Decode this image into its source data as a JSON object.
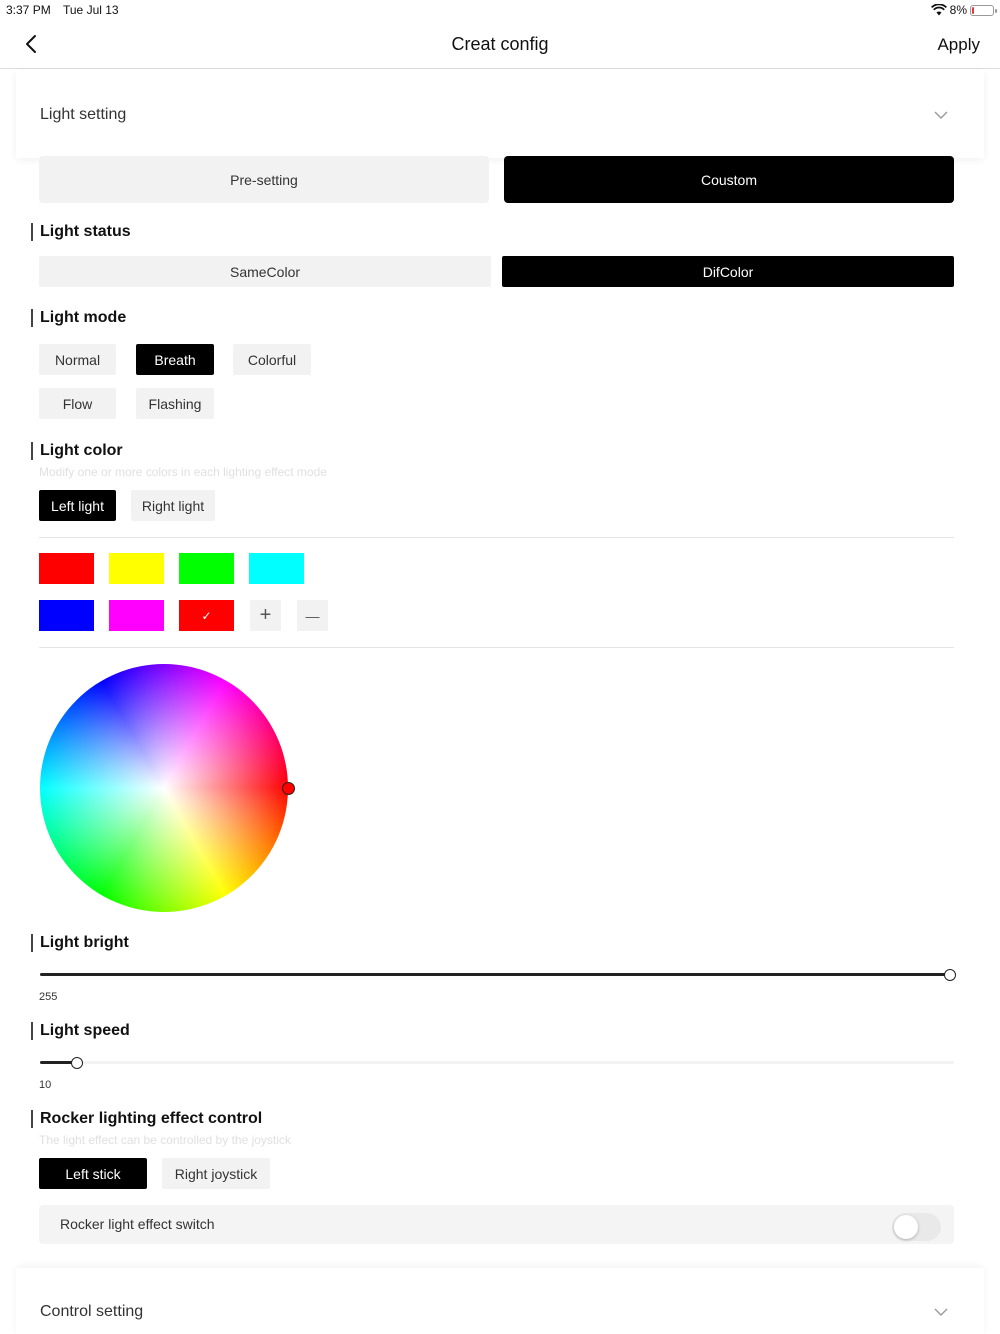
{
  "status_bar": {
    "time": "3:37 PM",
    "date": "Tue Jul 13",
    "battery": "8%"
  },
  "nav": {
    "title": "Creat config",
    "apply_label": "Apply"
  },
  "light_section": {
    "title": "Light setting",
    "expanded": true
  },
  "setting_mode": {
    "options": [
      "Pre-setting",
      "Coustom"
    ],
    "selected": "Coustom"
  },
  "light_status": {
    "label": "Light status",
    "options": [
      "SameColor",
      "DifColor"
    ],
    "selected": "DifColor"
  },
  "light_mode": {
    "label": "Light mode",
    "options": [
      "Normal",
      "Breath",
      "Colorful",
      "Flow",
      "Flashing"
    ],
    "selected": "Breath"
  },
  "light_color": {
    "label": "Light color",
    "subtitle": "Modify one or more colors in each lighting effect mode",
    "sides": [
      "Left light",
      "Right light"
    ],
    "selected_side": "Left light",
    "swatches": [
      "#ff0000",
      "#ffff00",
      "#00ff00",
      "#00ffff",
      "#0000ff",
      "#ff00ff",
      "#ff0000"
    ],
    "selected_swatch_index": 6,
    "check_mark": "✓",
    "add_symbol": "+",
    "remove_symbol": "—",
    "wheel_hue_deg": 0,
    "wheel_handle_color": "#ff0000"
  },
  "light_bright": {
    "label": "Light bright",
    "value": "255",
    "fraction": 1.0
  },
  "light_speed": {
    "label": "Light speed",
    "value": "10",
    "fraction": 0.04
  },
  "rocker": {
    "label": "Rocker lighting effect control",
    "subtitle": "The light effect can be controlled by the joystick",
    "options": [
      "Left stick",
      "Right joystick"
    ],
    "selected": "Left stick",
    "switch_label": "Rocker light effect switch",
    "switch_on": false
  },
  "control_section": {
    "title": "Control setting",
    "expanded": false
  },
  "colors": {
    "accent": "#000000",
    "chip_bg": "#f2f2f2",
    "battery_low": "#e53935"
  }
}
